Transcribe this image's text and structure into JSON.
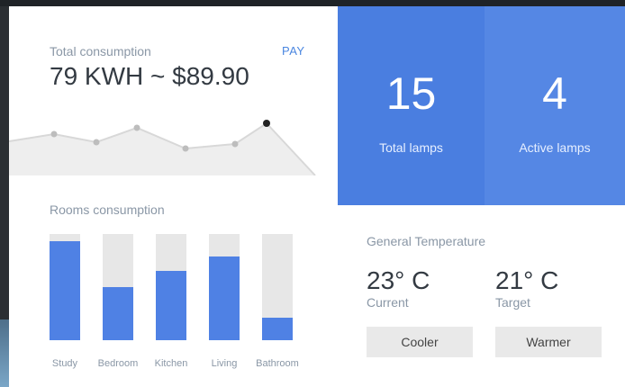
{
  "consumption": {
    "title": "Total consumption",
    "pay_label": "PAY",
    "value": "79 KWH ~ $89.90"
  },
  "rooms": {
    "title": "Rooms consumption",
    "items": [
      {
        "label": "Study",
        "fraction": 0.93
      },
      {
        "label": "Bedroom",
        "fraction": 0.5
      },
      {
        "label": "Kitchen",
        "fraction": 0.65
      },
      {
        "label": "Living",
        "fraction": 0.79
      },
      {
        "label": "Bathroom",
        "fraction": 0.21
      }
    ]
  },
  "stats": {
    "total_lamps": {
      "value": "15",
      "label": "Total lamps"
    },
    "active_lamps": {
      "value": "4",
      "label": "Active lamps"
    }
  },
  "temperature": {
    "title": "General Temperature",
    "current": {
      "value": "23° C",
      "label": "Current"
    },
    "target": {
      "value": "21° C",
      "label": "Target"
    },
    "cooler_label": "Cooler",
    "warmer_label": "Warmer"
  },
  "colors": {
    "accent": "#4a86e0",
    "bar": "#4f81e4",
    "tile_primary": "#4a7ee0",
    "tile_secondary": "#5587e4"
  }
}
